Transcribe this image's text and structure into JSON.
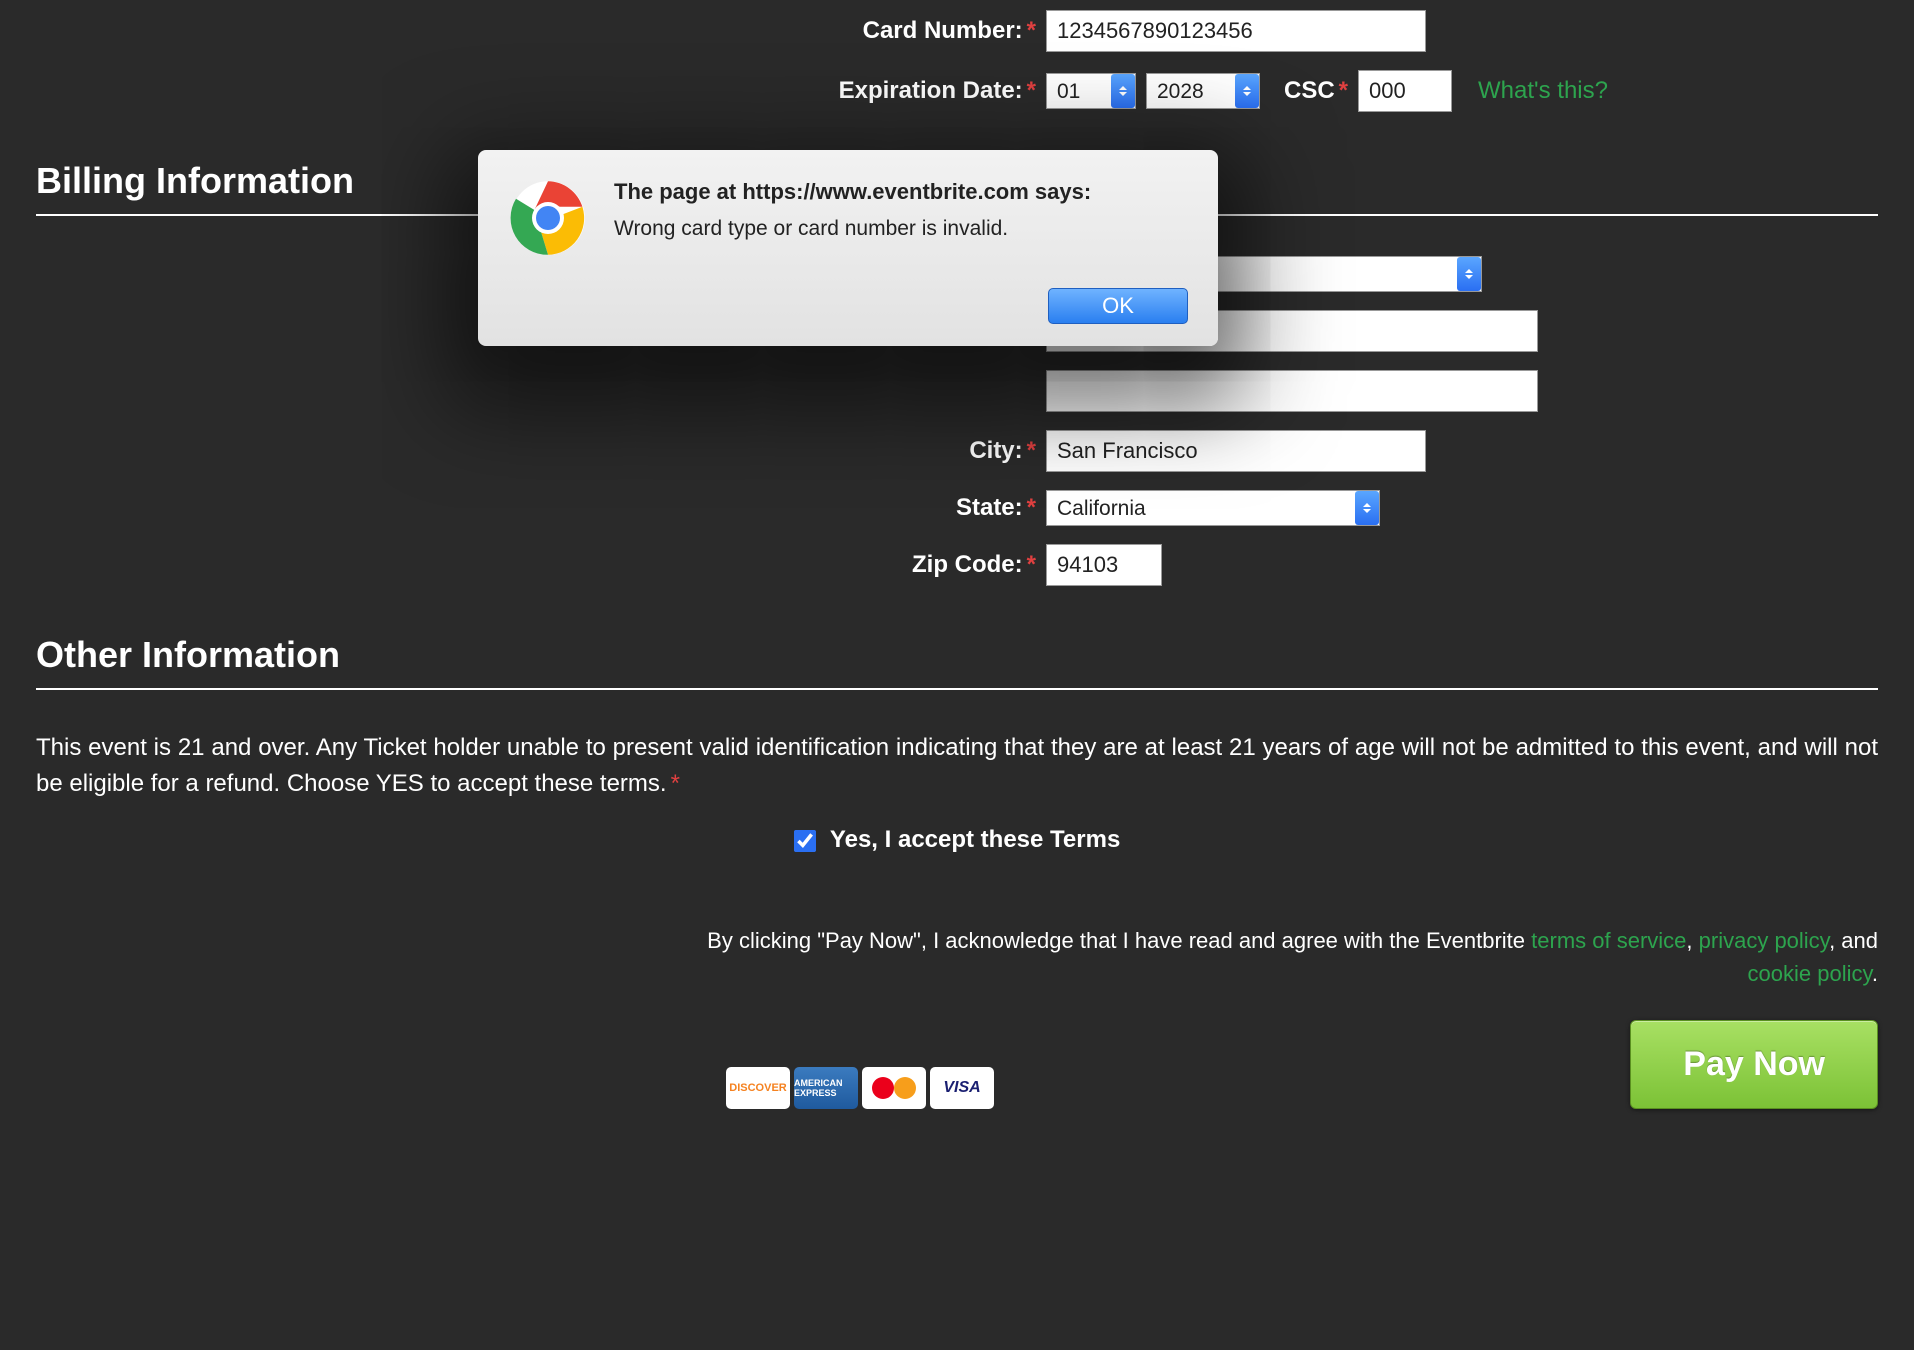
{
  "payment": {
    "card_number_label": "Card Number:",
    "card_number_value": "1234567890123456",
    "exp_label": "Expiration Date:",
    "exp_month": "01",
    "exp_year": "2028",
    "csc_label": "CSC",
    "csc_value": "000",
    "whats_this": "What's this?"
  },
  "billing": {
    "title": "Billing Information",
    "city_label": "City:",
    "city_value": "San Francisco",
    "state_label": "State:",
    "state_value": "California",
    "zip_label": "Zip Code:",
    "zip_value": "94103"
  },
  "other": {
    "title": "Other Information",
    "terms_text": "This event is 21 and over. Any Ticket holder unable to present valid identification indicating that they are at least 21 years of age will not be admitted to this event, and will not be eligible for a refund. Choose YES to accept these terms.",
    "accept_label": "Yes, I accept these Terms"
  },
  "ack": {
    "prefix": "By clicking \"Pay Now\", I acknowledge that I have read and agree with the Eventbrite ",
    "tos": "terms of service",
    "sep1": ", ",
    "privacy": "privacy policy",
    "sep2": ", and ",
    "cookie": "cookie policy",
    "suffix": "."
  },
  "cards": {
    "discover": "DISCOVER",
    "amex": "AMERICAN EXPRESS",
    "visa": "VISA"
  },
  "pay_button": "Pay Now",
  "modal": {
    "heading": "The page at https://www.eventbrite.com says:",
    "message": "Wrong card type or card number is invalid.",
    "ok": "OK"
  }
}
